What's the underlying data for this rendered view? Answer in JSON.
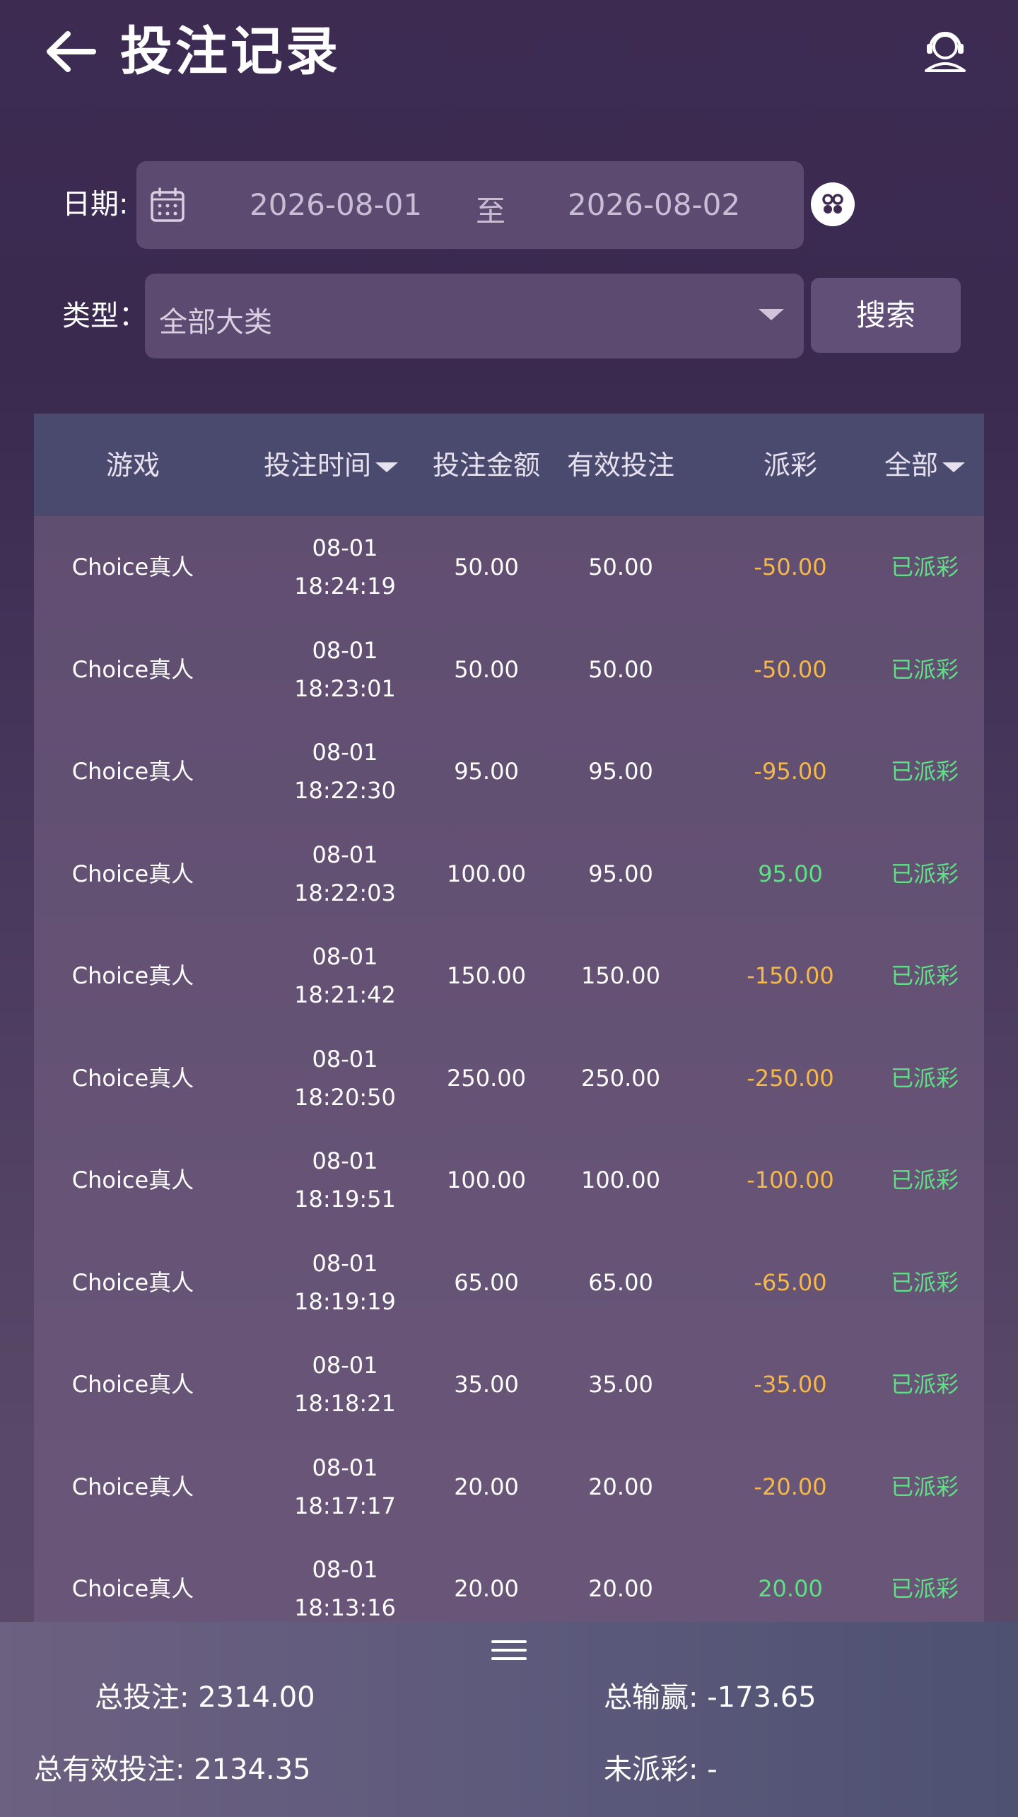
{
  "header": {
    "title": "投注记录"
  },
  "filters": {
    "date_label": "日期:",
    "date_start": "2026-08-01",
    "date_separator": "至",
    "date_end": "2026-08-02",
    "type_label": "类型：",
    "type_value": "全部大类",
    "search_label": "搜索"
  },
  "table": {
    "columns": [
      "游戏",
      "投注时间",
      "投注金额",
      "有效投注",
      "派彩",
      "全部"
    ],
    "rows": [
      {
        "game": "Choice真人",
        "date": "08-01",
        "time": "18:24:19",
        "bet": "50.00",
        "valid": "50.00",
        "payout": "-50.00",
        "status": "已派彩"
      },
      {
        "game": "Choice真人",
        "date": "08-01",
        "time": "18:23:01",
        "bet": "50.00",
        "valid": "50.00",
        "payout": "-50.00",
        "status": "已派彩"
      },
      {
        "game": "Choice真人",
        "date": "08-01",
        "time": "18:22:30",
        "bet": "95.00",
        "valid": "95.00",
        "payout": "-95.00",
        "status": "已派彩"
      },
      {
        "game": "Choice真人",
        "date": "08-01",
        "time": "18:22:03",
        "bet": "100.00",
        "valid": "95.00",
        "payout": "95.00",
        "status": "已派彩"
      },
      {
        "game": "Choice真人",
        "date": "08-01",
        "time": "18:21:42",
        "bet": "150.00",
        "valid": "150.00",
        "payout": "-150.00",
        "status": "已派彩"
      },
      {
        "game": "Choice真人",
        "date": "08-01",
        "time": "18:20:50",
        "bet": "250.00",
        "valid": "250.00",
        "payout": "-250.00",
        "status": "已派彩"
      },
      {
        "game": "Choice真人",
        "date": "08-01",
        "time": "18:19:51",
        "bet": "100.00",
        "valid": "100.00",
        "payout": "-100.00",
        "status": "已派彩"
      },
      {
        "game": "Choice真人",
        "date": "08-01",
        "time": "18:19:19",
        "bet": "65.00",
        "valid": "65.00",
        "payout": "-65.00",
        "status": "已派彩"
      },
      {
        "game": "Choice真人",
        "date": "08-01",
        "time": "18:18:21",
        "bet": "35.00",
        "valid": "35.00",
        "payout": "-35.00",
        "status": "已派彩"
      },
      {
        "game": "Choice真人",
        "date": "08-01",
        "time": "18:17:17",
        "bet": "20.00",
        "valid": "20.00",
        "payout": "-20.00",
        "status": "已派彩"
      },
      {
        "game": "Choice真人",
        "date": "08-01",
        "time": "18:13:16",
        "bet": "20.00",
        "valid": "20.00",
        "payout": "20.00",
        "status": "已派彩"
      }
    ]
  },
  "summary": {
    "total_bet_label": "总投注:",
    "total_bet": "2314.00",
    "total_winloss_label": "总输赢:",
    "total_winloss": "-173.65",
    "total_valid_label": "总有效投注:",
    "total_valid": "2134.35",
    "unpaid_label": "未派彩:",
    "unpaid": "-"
  },
  "colors": {
    "payout_negative": "#f5b94a",
    "payout_positive": "#5fe085",
    "status_paid": "#5fe085"
  },
  "icons": [
    "back-arrow-icon",
    "customer-service-icon",
    "calendar-icon",
    "grid-icon",
    "chevron-down-icon",
    "menu-icon"
  ]
}
